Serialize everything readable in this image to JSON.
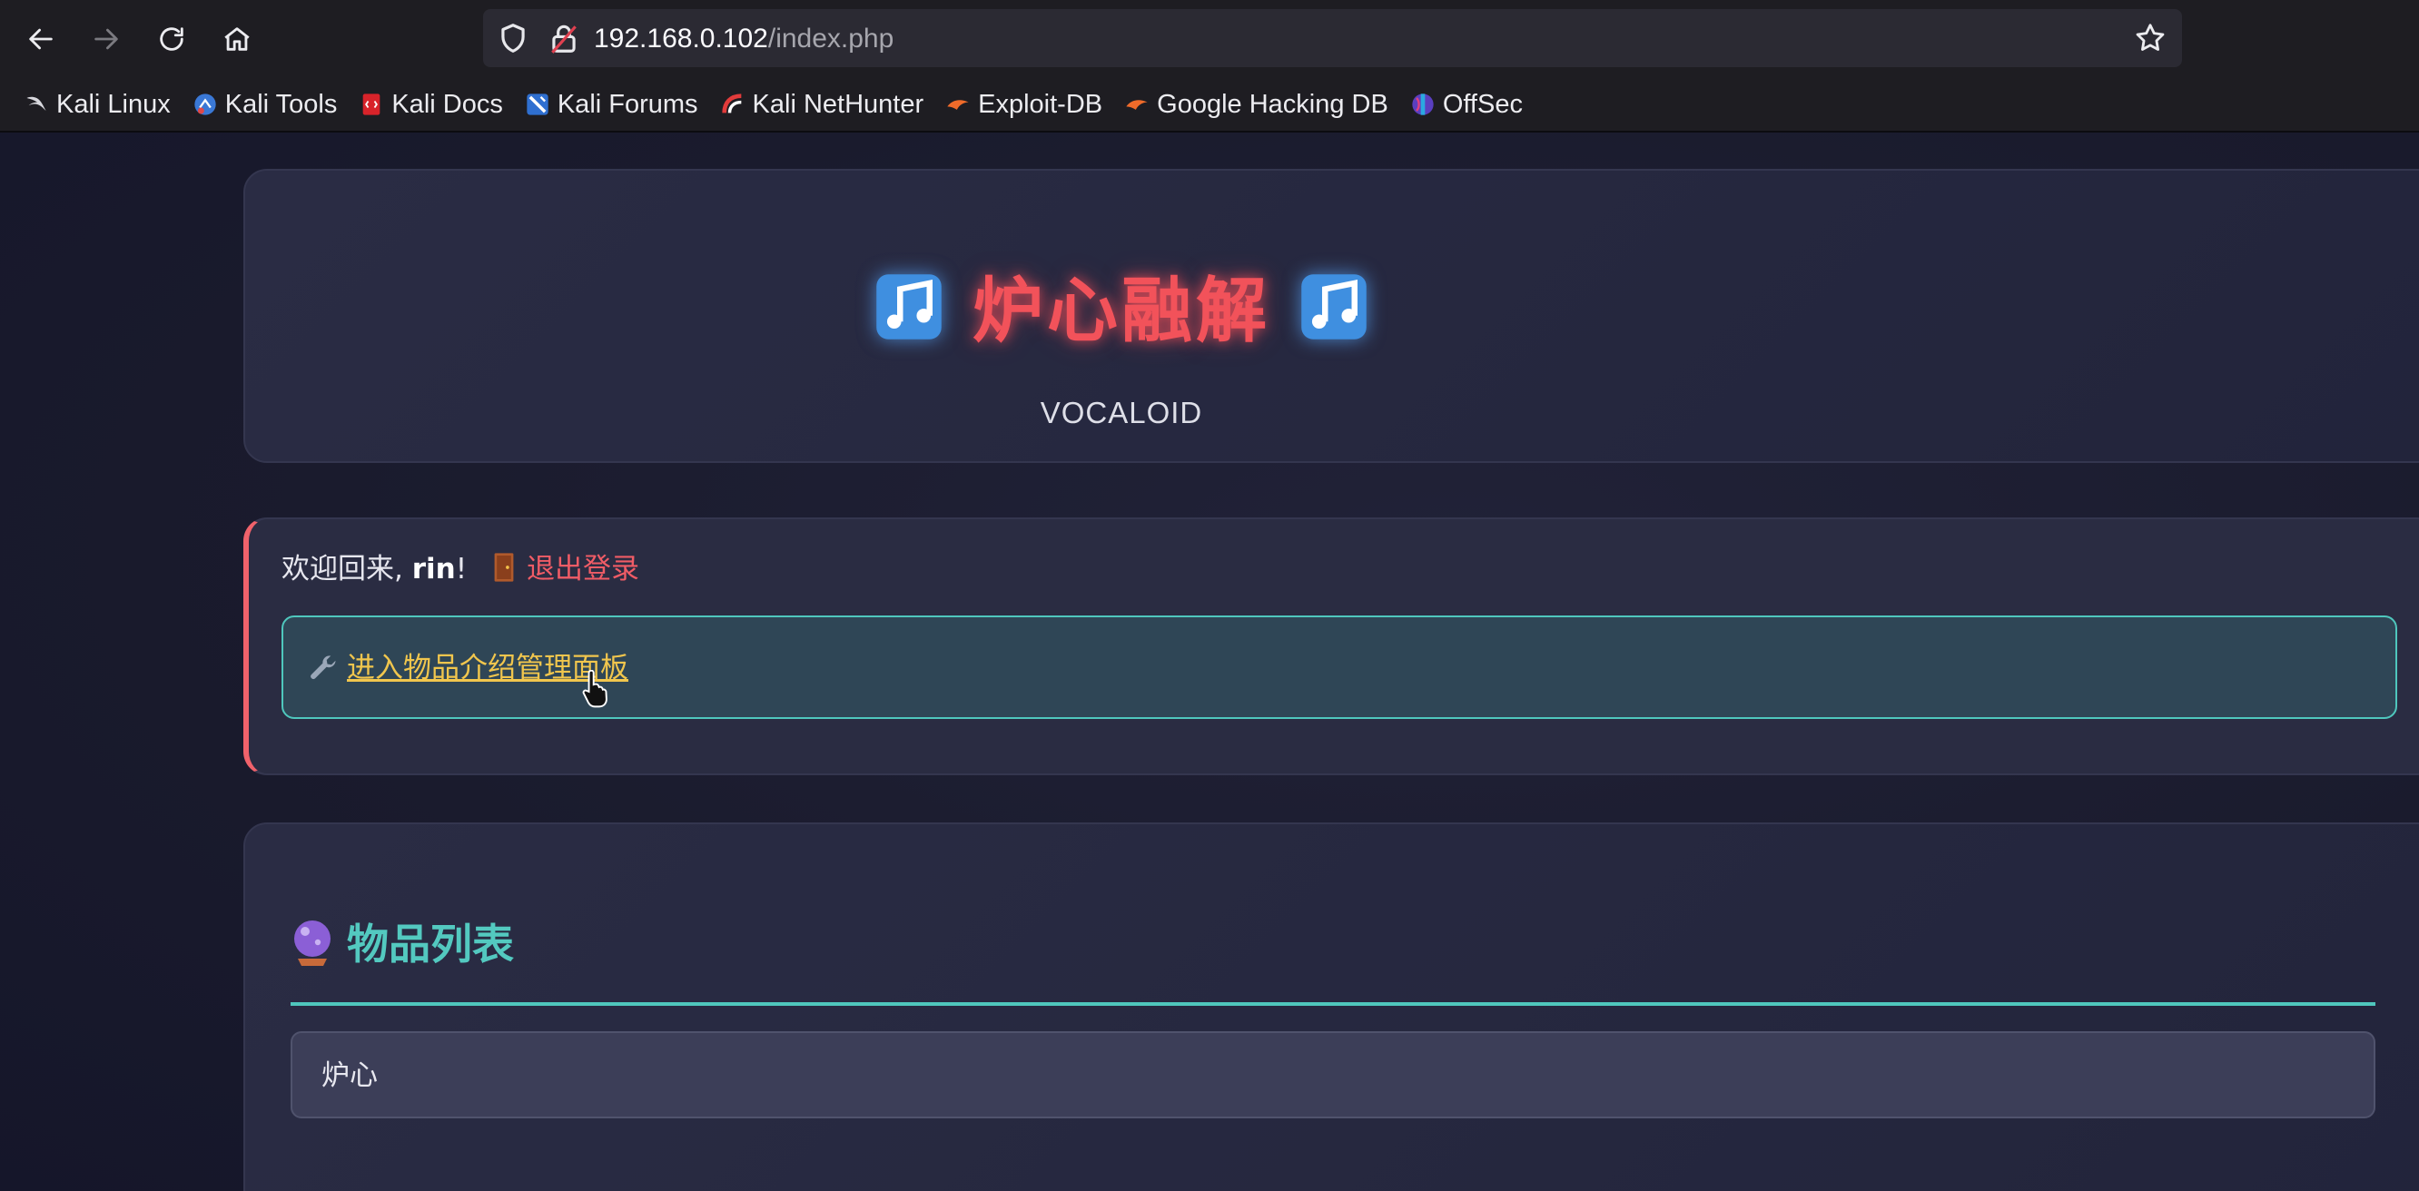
{
  "browser": {
    "url_host": "192.168.0.102",
    "url_path": "/index.php",
    "bookmarks": [
      {
        "label": "Kali Linux",
        "icon": "kali-dragon-icon"
      },
      {
        "label": "Kali Tools",
        "icon": "kali-tools-icon"
      },
      {
        "label": "Kali Docs",
        "icon": "kali-docs-icon"
      },
      {
        "label": "Kali Forums",
        "icon": "kali-forums-icon"
      },
      {
        "label": "Kali NetHunter",
        "icon": "kali-nethunter-icon"
      },
      {
        "label": "Exploit-DB",
        "icon": "exploit-db-icon"
      },
      {
        "label": "Google Hacking DB",
        "icon": "google-hacking-db-icon"
      },
      {
        "label": "OffSec",
        "icon": "offsec-icon"
      }
    ]
  },
  "header": {
    "title": "炉心融解",
    "subtitle": "VOCALOID",
    "title_icon": "musical-notes-icon",
    "title_color": "#f2525a"
  },
  "user": {
    "welcome_prefix": "欢迎回来, ",
    "username": "rin",
    "welcome_suffix": "!",
    "logout_label": "退出登录",
    "admin_link_label": "进入物品介绍管理面板"
  },
  "items": {
    "heading": "物品列表",
    "list": [
      "炉心"
    ]
  },
  "colors": {
    "accent_teal": "#4fc7bd",
    "accent_red": "#f05c66",
    "link_yellow": "#f1c64d"
  }
}
